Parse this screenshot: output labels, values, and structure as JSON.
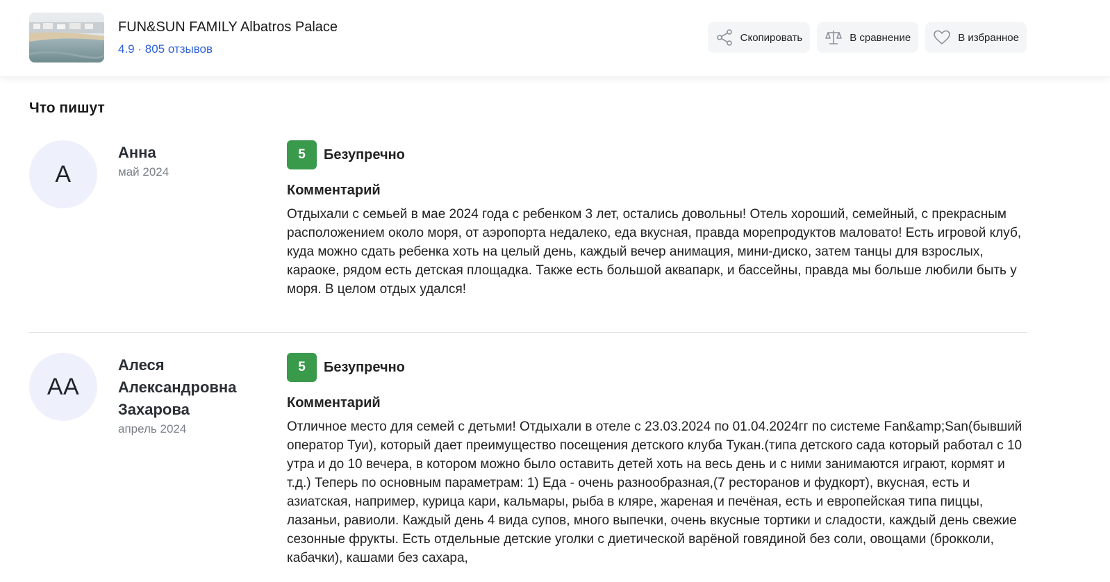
{
  "header": {
    "hotel_name": "FUN&SUN FAMILY Albatros Palace",
    "rating_text": "4.9 · 805 отзывов",
    "actions": {
      "copy_label": "Скопировать",
      "compare_label": "В сравнение",
      "favorite_label": "В избранное"
    },
    "icons": {
      "copy": "share-icon",
      "compare": "scales-icon",
      "favorite": "heart-icon"
    }
  },
  "section": {
    "title": "Что пишут"
  },
  "reviews": [
    {
      "initials": "А",
      "author": "Анна",
      "date": "май 2024",
      "score": "5",
      "score_label": "Безупречно",
      "comment_label": "Комментарий",
      "text": "Отдыхали с семьей в мае 2024 года с ребенком 3 лет, остались довольны! Отель хороший, семейный, с прекрасным расположением около моря, от аэропорта недалеко, еда вкусная, правда морепродуктов маловато! Есть игровой клуб, куда можно сдать ребенка хоть на целый день, каждый вечер анимация, мини-диско, затем танцы для взрослых, караоке, рядом есть детская площадка. Также есть большой аквапарк, и бассейны, правда мы больше любили быть у моря. В целом отдых удался!"
    },
    {
      "initials": "АА",
      "author": "Алеся Александровна Захарова",
      "date": "апрель 2024",
      "score": "5",
      "score_label": "Безупречно",
      "comment_label": "Комментарий",
      "text": "Отличное место для семей с детьми! Отдыхали в отеле с 23.03.2024 по 01.04.2024гг по системе Fan&amp;San(бывший оператор Туи), который дает преимущество посещения детского клуба Тукан.(типа детского сада который работал с 10 утра и до 10 вечера, в котором можно было оставить детей хоть на весь день и с ними занимаются играют, кормят и т.д.) Теперь по основным параметрам: 1) Еда - очень разнообразная,(7 ресторанов и фудкорт), вкусная, есть и азиатская, например, курица кари, кальмары, рыба в кляре, жареная и печёная, есть и европейская типа пиццы, лазаньи, равиоли. Каждый день 4 вида супов, много выпечки, очень вкусные тортики и сладости, каждый день свежие сезонные фрукты. Есть отдельные детские уголки с диетической варёной говядиной без соли, овощами (брокколи, кабачки), кашами без сахара,"
    }
  ],
  "colors": {
    "accent_link": "#2f62d8",
    "score_green": "#3a9a4c",
    "avatar_bg": "#eef0fb"
  }
}
